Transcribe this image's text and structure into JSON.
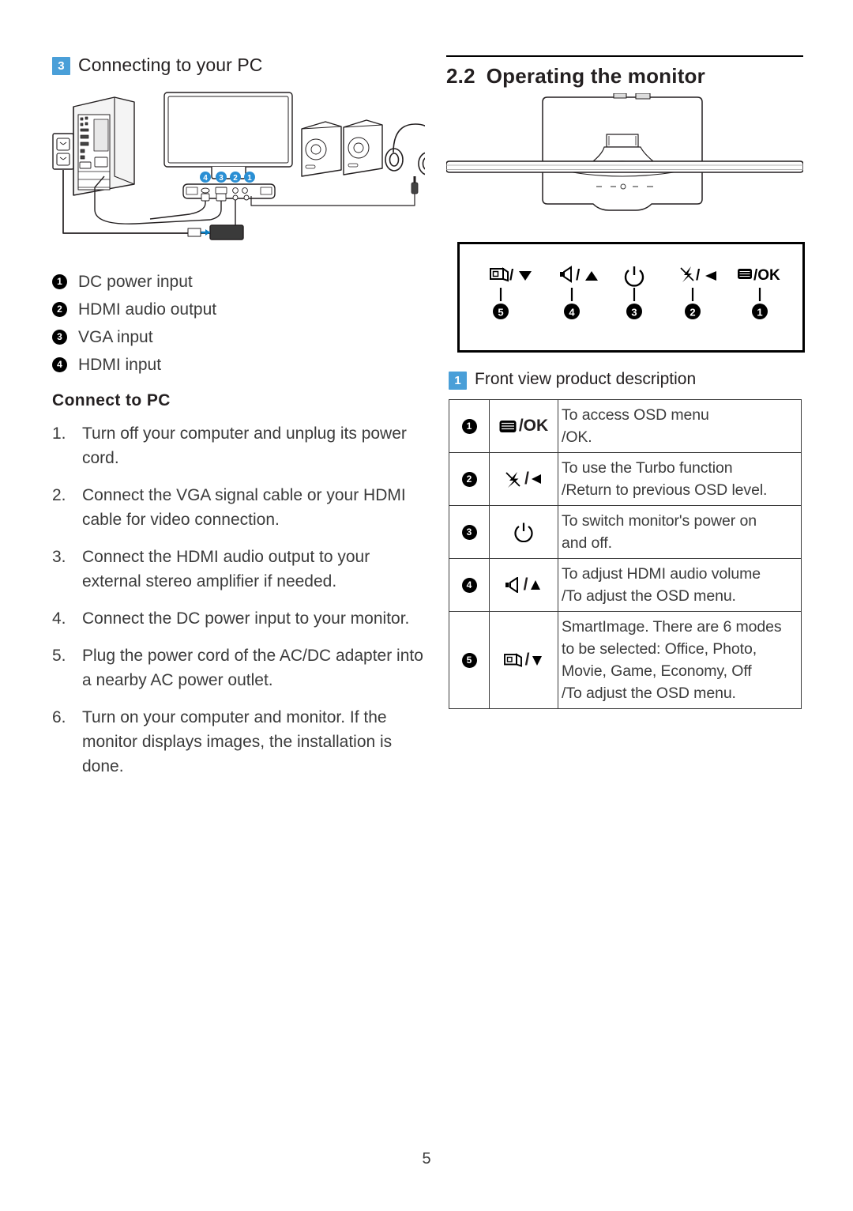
{
  "page": {
    "number": "5"
  },
  "left": {
    "section_badge": "3",
    "section_title": "Connecting to your PC",
    "diagram": {
      "name": "pc-connection-diagram",
      "callouts": [
        "4",
        "3",
        "2",
        "1"
      ],
      "parts": [
        "wall-outlet",
        "desktop-pc-tower",
        "monitor",
        "speakers",
        "headphones",
        "ac-dc-adapter"
      ]
    },
    "port_legend": [
      {
        "num": "1",
        "label": "DC power input"
      },
      {
        "num": "2",
        "label": "HDMI audio output"
      },
      {
        "num": "3",
        "label": "VGA input"
      },
      {
        "num": "4",
        "label": "HDMI input"
      }
    ],
    "connect_title": "Connect to PC",
    "steps": [
      {
        "num": "1.",
        "text": "Turn off your computer and unplug its power cord."
      },
      {
        "num": "2.",
        "text": "Connect the VGA signal cable or your HDMI cable for video connection."
      },
      {
        "num": "3.",
        "text": "Connect the HDMI audio output to your external stereo amplifier if needed."
      },
      {
        "num": "4.",
        "text": "Connect the DC power input to your monitor."
      },
      {
        "num": "5.",
        "text": "Plug the power cord of the AC/DC adapter into a nearby AC power outlet."
      },
      {
        "num": "6.",
        "text": "Turn on your computer and monitor. If the monitor displays images, the installation is done."
      }
    ]
  },
  "right": {
    "section_number": "2.2",
    "section_title": "Operating the monitor",
    "monitor_figure_name": "monitor-front-view-illustration",
    "controls_figure": {
      "name": "front-control-buttons-diagram",
      "buttons": [
        {
          "callout": "5",
          "icon": "smartimage-icon",
          "suffix": "/",
          "arrow": "down-triangle-icon"
        },
        {
          "callout": "4",
          "icon": "speaker-volume-icon",
          "suffix": "/",
          "arrow": "up-triangle-icon"
        },
        {
          "callout": "3",
          "icon": "power-icon",
          "suffix": "",
          "arrow": ""
        },
        {
          "callout": "2",
          "icon": "turbo-icon",
          "suffix": "/",
          "arrow": "left-triangle-icon"
        },
        {
          "callout": "1",
          "icon": "osd-menu-icon",
          "suffix": "/",
          "arrow": "OK"
        }
      ]
    },
    "frontview_badge": "1",
    "frontview_title": "Front view product description",
    "table": {
      "rows": [
        {
          "num": "1",
          "icon": "osd-menu-icon",
          "icon_text": "/OK",
          "desc_line1": "To access OSD menu",
          "desc_line2": "/OK."
        },
        {
          "num": "2",
          "icon": "turbo-icon",
          "icon_text": "/",
          "desc_line1": "To use the Turbo function",
          "desc_line2": "/Return to previous OSD level."
        },
        {
          "num": "3",
          "icon": "power-icon",
          "icon_text": "",
          "desc_line1": "To switch monitor's power on",
          "desc_line2": "and off."
        },
        {
          "num": "4",
          "icon": "speaker-volume-icon",
          "icon_text": "/",
          "desc_line1": "To adjust HDMI audio volume",
          "desc_line2": "/To adjust the OSD menu."
        },
        {
          "num": "5",
          "icon": "smartimage-icon",
          "icon_text": "/",
          "desc_line1": "SmartImage. There are 6 modes",
          "desc_line2": "to be selected: Office, Photo,",
          "desc_line3": "Movie, Game, Economy, Off",
          "desc_line4": "/To adjust the OSD menu."
        }
      ]
    }
  },
  "colors": {
    "badge_blue": "#4a9fd8",
    "text": "#3b3b3b",
    "rule": "#000000"
  }
}
